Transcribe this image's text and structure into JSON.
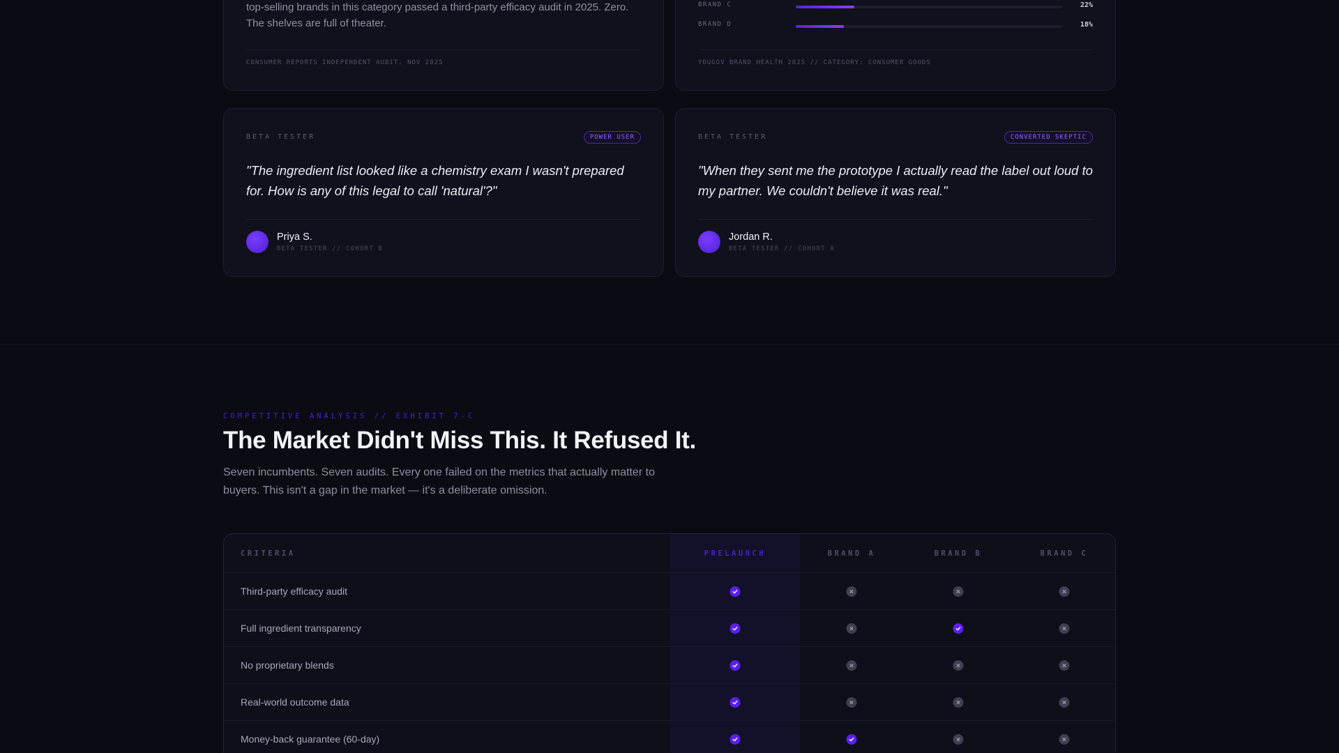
{
  "audit_card": {
    "text": "top-selling brands in this category passed a third-party efficacy audit in 2025. Zero. The shelves are full of theater.",
    "source": "CONSUMER REPORTS INDEPENDENT AUDIT, NOV 2025"
  },
  "brand_health_card": {
    "bars": [
      {
        "label": "BRAND C",
        "value": "22%",
        "fraction": 0.22
      },
      {
        "label": "BRAND D",
        "value": "18%",
        "fraction": 0.18
      }
    ],
    "source": "YOUGOV BRAND HEALTH 2025 // CATEGORY: CONSUMER GOODS"
  },
  "testimonials": [
    {
      "role": "BETA TESTER",
      "badge": "POWER USER",
      "quote": "\"The ingredient list looked like a chemistry exam I wasn't prepared for. How is any of this legal to call 'natural'?\"",
      "name": "Priya S.",
      "meta": "BETA TESTER // COHORT B"
    },
    {
      "role": "BETA TESTER",
      "badge": "CONVERTED SKEPTIC",
      "quote": "\"When they sent me the prototype I actually read the label out loud to my partner. We couldn't believe it was real.\"",
      "name": "Jordan R.",
      "meta": "BETA TESTER // COHORT A"
    }
  ],
  "section": {
    "eyebrow": "COMPETITIVE ANALYSIS // EXHIBIT 7-C",
    "headline": "The Market Didn't Miss This. It Refused It.",
    "lede": "Seven incumbents. Seven audits. Every one failed on the metrics that actually matter to buyers. This isn't a gap in the market — it's a deliberate omission."
  },
  "table": {
    "headers": [
      "CRITERIA",
      "PRELAUNCH",
      "BRAND A",
      "BRAND B",
      "BRAND C"
    ],
    "rows": [
      {
        "label": "Third-party efficacy audit",
        "marks": [
          true,
          false,
          false,
          false
        ]
      },
      {
        "label": "Full ingredient transparency",
        "marks": [
          true,
          false,
          true,
          false
        ]
      },
      {
        "label": "No proprietary blends",
        "marks": [
          true,
          false,
          false,
          false
        ]
      },
      {
        "label": "Real-world outcome data",
        "marks": [
          true,
          false,
          false,
          false
        ]
      },
      {
        "label": "Money-back guarantee (60-day)",
        "marks": [
          true,
          true,
          false,
          false
        ]
      }
    ]
  },
  "colors": {
    "accent": "#5a1ff0",
    "background": "#0b0c13",
    "card": "#10111c"
  },
  "icons": {
    "yes": "check-circle-icon",
    "no": "x-circle-icon"
  }
}
